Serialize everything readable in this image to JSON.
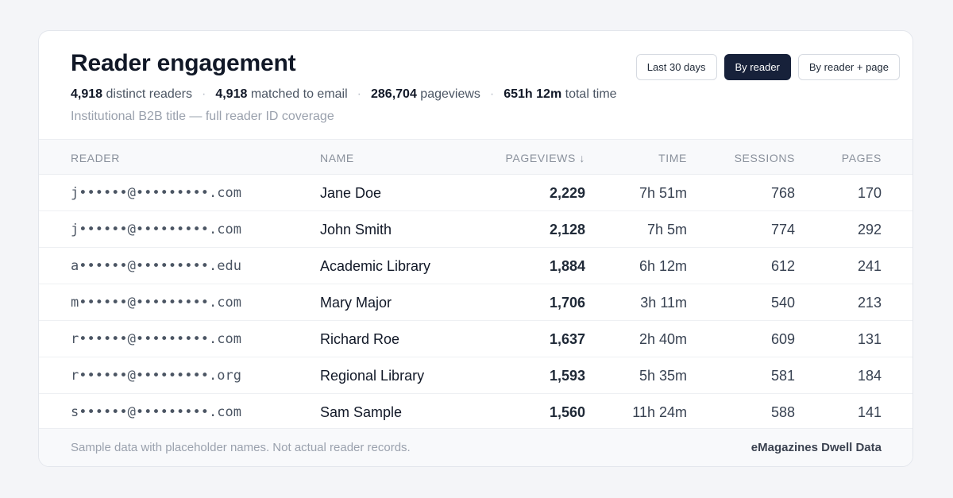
{
  "header": {
    "title": "Reader engagement",
    "stats": [
      {
        "value": "4,918",
        "label": "distinct readers"
      },
      {
        "value": "4,918",
        "label": "matched to email"
      },
      {
        "value": "286,704",
        "label": "pageviews"
      },
      {
        "value": "651h 12m",
        "label": "total time"
      }
    ],
    "separator": "·",
    "subtitle": "Institutional B2B title — full reader ID coverage"
  },
  "controls": {
    "range": "Last 30 days",
    "by_reader": "By reader",
    "by_reader_page": "By reader + page",
    "active": "By reader"
  },
  "table": {
    "columns": {
      "reader": "READER",
      "name": "NAME",
      "pageviews": "PAGEVIEWS ↓",
      "time": "TIME",
      "sessions": "SESSIONS",
      "pages": "PAGES"
    },
    "rows": [
      {
        "email": "j••••••@•••••••••.com",
        "name": "Jane Doe",
        "pageviews": "2,229",
        "time": "7h 51m",
        "sessions": "768",
        "pages": "170"
      },
      {
        "email": "j••••••@•••••••••.com",
        "name": "John Smith",
        "pageviews": "2,128",
        "time": "7h 5m",
        "sessions": "774",
        "pages": "292"
      },
      {
        "email": "a••••••@•••••••••.edu",
        "name": "Academic Library",
        "pageviews": "1,884",
        "time": "6h 12m",
        "sessions": "612",
        "pages": "241"
      },
      {
        "email": "m••••••@•••••••••.com",
        "name": "Mary Major",
        "pageviews": "1,706",
        "time": "3h 11m",
        "sessions": "540",
        "pages": "213"
      },
      {
        "email": "r••••••@•••••••••.com",
        "name": "Richard Roe",
        "pageviews": "1,637",
        "time": "2h 40m",
        "sessions": "609",
        "pages": "131"
      },
      {
        "email": "r••••••@•••••••••.org",
        "name": "Regional Library",
        "pageviews": "1,593",
        "time": "5h 35m",
        "sessions": "581",
        "pages": "184"
      },
      {
        "email": "s••••••@•••••••••.com",
        "name": "Sam Sample",
        "pageviews": "1,560",
        "time": "11h 24m",
        "sessions": "588",
        "pages": "141"
      }
    ]
  },
  "footer": {
    "note": "Sample data with placeholder names. Not actual reader records.",
    "brand": "eMagazines Dwell Data"
  },
  "colors": {
    "accent": "#17213a",
    "background": "#f4f5f8",
    "card": "#ffffff"
  }
}
